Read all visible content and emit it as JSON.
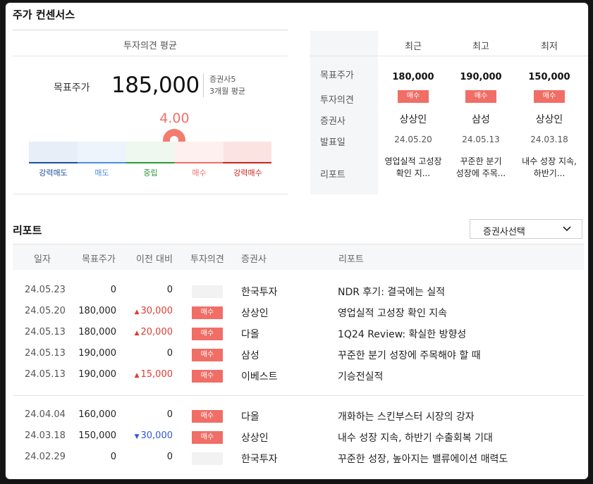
{
  "consensus": {
    "title": "주가 컨센서스",
    "avg_header": "투자의견 평균",
    "target_label": "목표주가",
    "target_value": "185,000",
    "firm_count": "증권사5",
    "period_note": "3개월 평균",
    "score": "4.00",
    "score_fraction": 0.6,
    "scale": [
      "강력매도",
      "매도",
      "중립",
      "매수",
      "강력매수"
    ],
    "scale_colors": {
      "strong_sell": "#1e4f9e",
      "sell": "#4b8de0",
      "neutral": "#2a9a3a",
      "buy": "#f0706a",
      "strong_buy": "#c8261e"
    },
    "row_labels": [
      "목표주가",
      "투자의견",
      "증권사",
      "발표일",
      "리포트"
    ],
    "columns": [
      {
        "header": "최근",
        "target": "180,000",
        "opinion": "매수",
        "firm": "상상인",
        "date": "24.05.20",
        "report": "영업실적 고성장 확인 지..."
      },
      {
        "header": "최고",
        "target": "190,000",
        "opinion": "매수",
        "firm": "삼성",
        "date": "24.05.13",
        "report": "꾸준한 분기 성장에 주목..."
      },
      {
        "header": "최저",
        "target": "150,000",
        "opinion": "매수",
        "firm": "상상인",
        "date": "24.03.18",
        "report": "내수 성장 지속, 하반기..."
      }
    ]
  },
  "reports": {
    "title": "리포트",
    "filter_label": "증권사선택",
    "headers": [
      "일자",
      "목표주가",
      "이전 대비",
      "투자의견",
      "증권사",
      "리포트"
    ],
    "rows": [
      {
        "date": "24.05.23",
        "target": "0",
        "change": "0",
        "dir": "none",
        "opinion": "",
        "firm": "한국투자",
        "title": "NDR 후기: 결국에는 실적"
      },
      {
        "date": "24.05.20",
        "target": "180,000",
        "change": "30,000",
        "dir": "up",
        "opinion": "매수",
        "firm": "상상인",
        "title": "영업실적 고성장 확인 지속"
      },
      {
        "date": "24.05.13",
        "target": "180,000",
        "change": "20,000",
        "dir": "up",
        "opinion": "매수",
        "firm": "다올",
        "title": "1Q24 Review: 확실한 방향성"
      },
      {
        "date": "24.05.13",
        "target": "190,000",
        "change": "0",
        "dir": "none",
        "opinion": "매수",
        "firm": "삼성",
        "title": "꾸준한 분기 성장에 주목해야 할 때"
      },
      {
        "date": "24.05.13",
        "target": "190,000",
        "change": "15,000",
        "dir": "up",
        "opinion": "매수",
        "firm": "이베스트",
        "title": "기승전실적"
      },
      {
        "date": "24.04.04",
        "target": "160,000",
        "change": "0",
        "dir": "none",
        "opinion": "매수",
        "firm": "다올",
        "title": "개화하는 스킨부스터 시장의 강자"
      },
      {
        "date": "24.03.18",
        "target": "150,000",
        "change": "30,000",
        "dir": "down",
        "opinion": "매수",
        "firm": "상상인",
        "title": "내수 성장 지속, 하반기 수출회복 기대"
      },
      {
        "date": "24.02.29",
        "target": "0",
        "change": "0",
        "dir": "none",
        "opinion": "",
        "firm": "한국투자",
        "title": "꾸준한 성장, 높아지는 밸류에이션 매력도"
      }
    ]
  }
}
